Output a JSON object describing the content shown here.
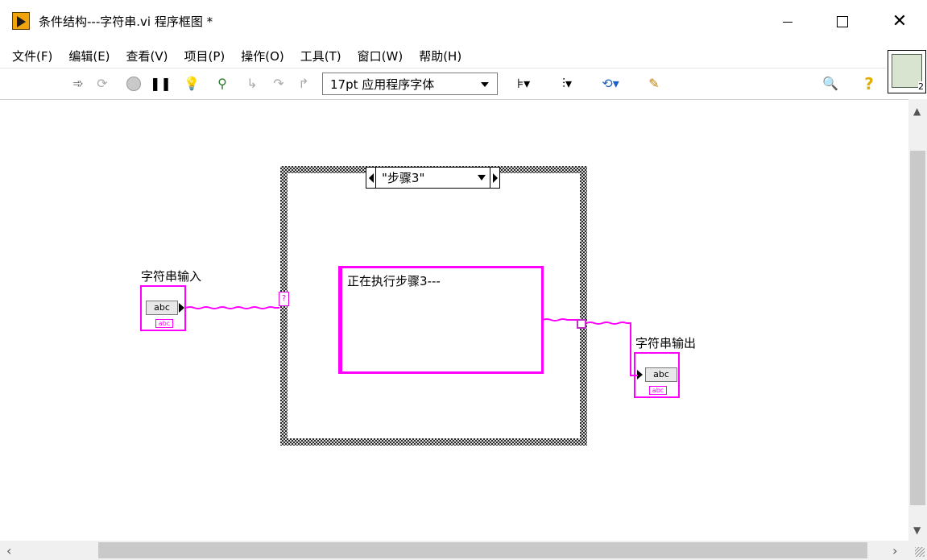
{
  "window": {
    "title": "条件结构---字符串.vi 程序框图 *",
    "close_glyph": "✕"
  },
  "menu": [
    {
      "label": "文件(F)"
    },
    {
      "label": "编辑(E)"
    },
    {
      "label": "查看(V)"
    },
    {
      "label": "项目(P)"
    },
    {
      "label": "操作(O)"
    },
    {
      "label": "工具(T)"
    },
    {
      "label": "窗口(W)"
    },
    {
      "label": "帮助(H)"
    }
  ],
  "toolbar": {
    "font_select": "17pt 应用程序字体",
    "icons": [
      "run-arrow-icon",
      "run-continuously-icon",
      "abort-icon",
      "pause-icon",
      "highlight-execution-icon",
      "retain-wire-values-icon",
      "step-into-icon",
      "step-over-icon",
      "step-out-icon",
      "align-objects-icon",
      "distribute-objects-icon",
      "reorder-icon",
      "clean-diagram-icon",
      "search-icon",
      "help-icon"
    ]
  },
  "connector_pane": {
    "number": "2"
  },
  "diagram": {
    "case_selector_value": "\"步骤3\"",
    "selector_terminal_glyph": "?",
    "string_constant": "正在执行步骤3---",
    "input_terminal": {
      "label": "字符串输入",
      "box_text": "abc",
      "tag_text": "abc"
    },
    "output_terminal": {
      "label": "字符串输出",
      "box_text": "abc",
      "tag_text": "abc"
    }
  },
  "colors": {
    "string_wire": "#ff00ff",
    "case_border_dark": "#2b2b2b",
    "app_icon": "#f0a30a"
  }
}
